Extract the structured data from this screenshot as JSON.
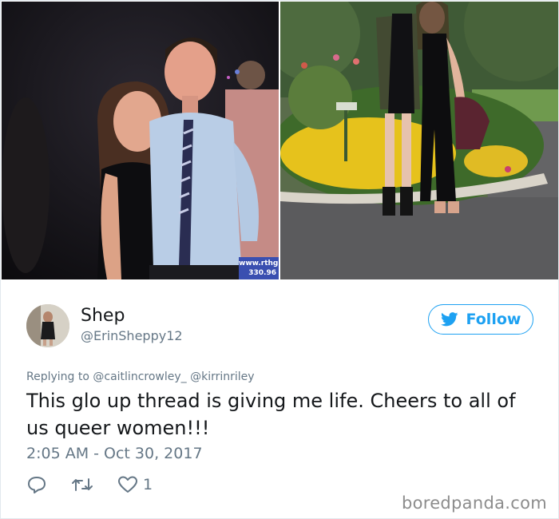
{
  "photos": {
    "left_watermark": "www.rthg\n330.96"
  },
  "user": {
    "name": "Shep",
    "handle": "@ErinSheppy12"
  },
  "follow_button": {
    "label": "Follow"
  },
  "tweet": {
    "replying_prefix": "Replying to",
    "mention_1": "@caitlincrowley_",
    "mention_2": "@kirrinriley",
    "text": "This glo up thread is giving me life. Cheers to all of us queer women!!!",
    "timestamp": "2:05 AM - Oct 30, 2017"
  },
  "actions": {
    "reply_icon": "reply-icon",
    "retweet_icon": "retweet-icon",
    "like_icon": "heart-icon",
    "like_count": "1"
  },
  "brand": "boredpanda.com",
  "colors": {
    "accent": "#1da1f2",
    "muted": "#657786",
    "text": "#14171a"
  }
}
